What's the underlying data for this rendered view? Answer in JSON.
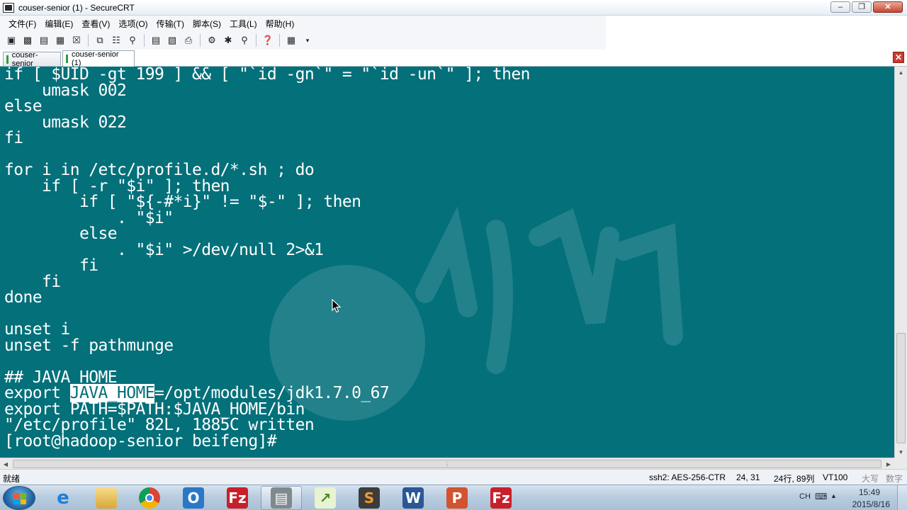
{
  "window": {
    "title": "couser-senior (1) - SecureCRT"
  },
  "menu": [
    "文件(F)",
    "编辑(E)",
    "查看(V)",
    "选项(O)",
    "传输(T)",
    "脚本(S)",
    "工具(L)",
    "帮助(H)"
  ],
  "tabs": [
    {
      "label": "couser-senior",
      "active": false
    },
    {
      "label": "couser-senior (1)",
      "active": true
    }
  ],
  "terminal": {
    "background": "#03707a",
    "lines": [
      "if [ $UID -gt 199 ] && [ \"`id -gn`\" = \"`id -un`\" ]; then",
      "    umask 002",
      "else",
      "    umask 022",
      "fi",
      "",
      "for i in /etc/profile.d/*.sh ; do",
      "    if [ -r \"$i\" ]; then",
      "        if [ \"${-#*i}\" != \"$-\" ]; then",
      "            . \"$i\"",
      "        else",
      "            . \"$i\" >/dev/null 2>&1",
      "        fi",
      "    fi",
      "done",
      "",
      "unset i",
      "unset -f pathmunge",
      "",
      "## JAVA_HOME"
    ],
    "export_line": {
      "prefix": "export ",
      "highlight": "JAVA_HOME",
      "rest": "=/opt/modules/jdk1.7.0_67"
    },
    "tail_lines": [
      "export PATH=$PATH:$JAVA_HOME/bin",
      "\"/etc/profile\" 82L, 1885C written",
      "[root@hadoop-senior beifeng]#"
    ]
  },
  "status": {
    "ready": "就绪",
    "cipher": "ssh2: AES-256-CTR",
    "cursor": "24,  31",
    "size": "24行, 89列",
    "emulation": "VT100",
    "caps": "大写",
    "num": "数字"
  },
  "taskbar": {
    "apps": [
      "windows-explorer",
      "internet-explorer",
      "chrome",
      "outlook",
      "filezilla",
      "securecrt",
      "notepad-chart",
      "sublime-text",
      "word",
      "powerpoint",
      "filezilla"
    ],
    "tray_lang": "CH",
    "time": "15:49",
    "date": "2015/8/16"
  }
}
